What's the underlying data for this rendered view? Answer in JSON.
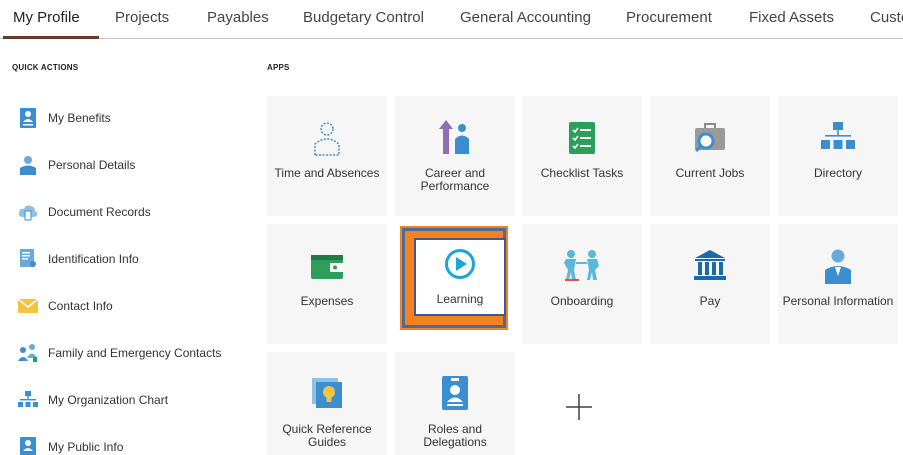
{
  "nav": {
    "tabs": [
      {
        "label": "My Profile"
      },
      {
        "label": "Projects"
      },
      {
        "label": "Payables"
      },
      {
        "label": "Budgetary Control"
      },
      {
        "label": "General Accounting"
      },
      {
        "label": "Procurement"
      },
      {
        "label": "Fixed Assets"
      },
      {
        "label": "Custo"
      }
    ]
  },
  "quick_actions": {
    "heading": "QUICK ACTIONS",
    "items": [
      {
        "label": "My Benefits",
        "icon": "benefits-icon"
      },
      {
        "label": "Personal Details",
        "icon": "person-icon"
      },
      {
        "label": "Document Records",
        "icon": "cloud-document-icon"
      },
      {
        "label": "Identification Info",
        "icon": "id-card-icon"
      },
      {
        "label": "Contact Info",
        "icon": "envelope-icon"
      },
      {
        "label": "Family and Emergency Contacts",
        "icon": "family-icon"
      },
      {
        "label": "My Organization Chart",
        "icon": "org-chart-icon"
      },
      {
        "label": "My Public Info",
        "icon": "public-profile-icon"
      }
    ]
  },
  "apps": {
    "heading": "APPS",
    "tiles": [
      {
        "label": "Time and Absences",
        "icon": "person-outline-icon"
      },
      {
        "label": "Career and Performance",
        "icon": "career-growth-icon"
      },
      {
        "label": "Checklist Tasks",
        "icon": "checklist-icon"
      },
      {
        "label": "Current Jobs",
        "icon": "briefcase-search-icon"
      },
      {
        "label": "Directory",
        "icon": "directory-icon"
      },
      {
        "label": "Expenses",
        "icon": "wallet-icon"
      },
      {
        "label": "Learning",
        "icon": "play-circle-icon"
      },
      {
        "label": "Onboarding",
        "icon": "onboarding-icon"
      },
      {
        "label": "Pay",
        "icon": "bank-icon"
      },
      {
        "label": "Personal Information",
        "icon": "person-icon"
      },
      {
        "label": "Quick Reference Guides",
        "icon": "lightbulb-icon"
      },
      {
        "label": "Roles and Delegations",
        "icon": "badge-icon"
      }
    ],
    "add_icon": "plus-icon"
  },
  "colors": {
    "accent_underline": "#6b3a22",
    "highlight": "#f58220",
    "highlight_frame": "#3c5a8a",
    "icon_blue": "#3b8fd1",
    "icon_green": "#2e9e5b"
  }
}
